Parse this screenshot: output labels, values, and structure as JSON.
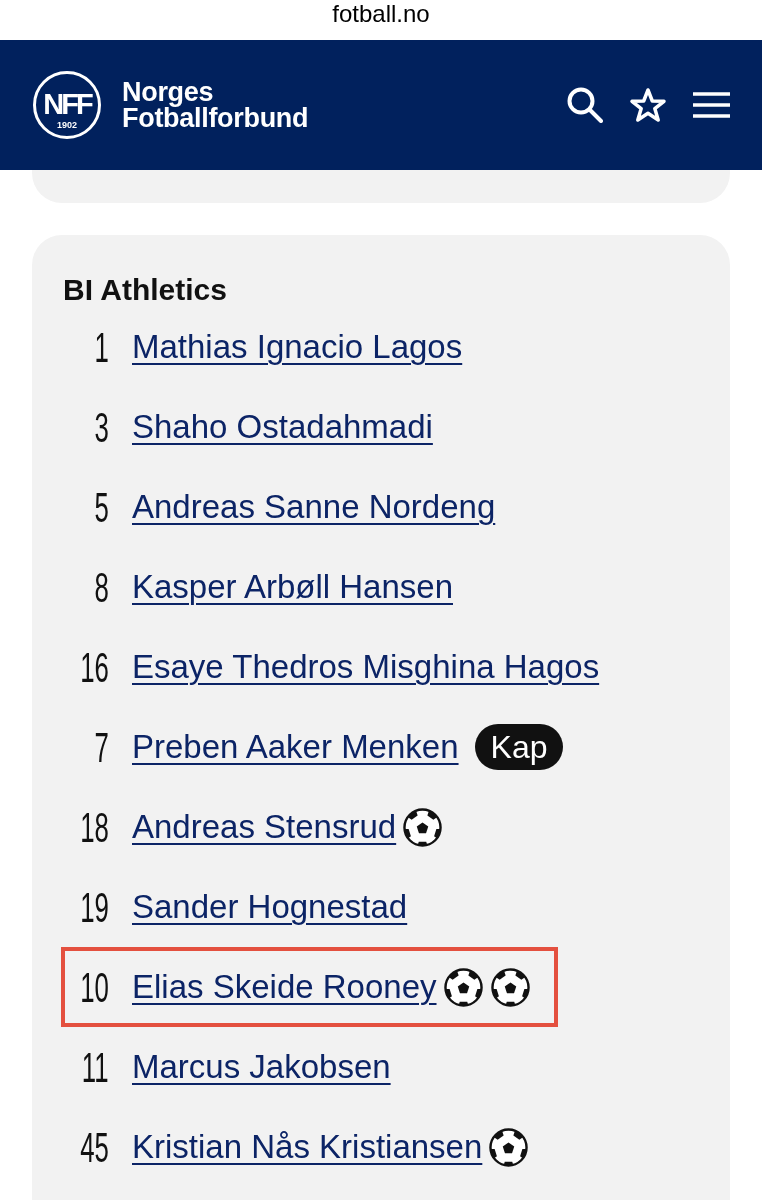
{
  "browser": {
    "address": "fotball.no"
  },
  "header": {
    "logo": {
      "monogram": "NFF",
      "year": "1902"
    },
    "title_lines": [
      "Norges",
      "Fotballforbund"
    ],
    "actions": [
      {
        "kind": "search"
      },
      {
        "kind": "favorite"
      },
      {
        "kind": "menu"
      }
    ]
  },
  "squad": {
    "team": "BI Athletics",
    "players": [
      {
        "number": "1",
        "name": "Mathias Ignacio Lagos",
        "highlighted": false
      },
      {
        "number": "3",
        "name": "Shaho Ostadahmadi",
        "highlighted": false
      },
      {
        "number": "5",
        "name": "Andreas Sanne Nordeng",
        "highlighted": false
      },
      {
        "number": "8",
        "name": "Kasper Arbøll Hansen",
        "highlighted": false
      },
      {
        "number": "16",
        "name": "Esaye Thedros Misghina Hagos",
        "highlighted": false
      },
      {
        "number": "7",
        "name": "Preben Aaker Menken",
        "tag": "Kap",
        "highlighted": false
      },
      {
        "number": "18",
        "name": "Andreas Stensrud",
        "events": [
          {
            "kind": "goal"
          }
        ],
        "highlighted": false
      },
      {
        "number": "19",
        "name": "Sander Hognestad",
        "highlighted": false
      },
      {
        "number": "10",
        "name": "Elias Skeide Rooney",
        "events": [
          {
            "kind": "goal"
          },
          {
            "kind": "goal"
          }
        ],
        "highlighted": true
      },
      {
        "number": "11",
        "name": "Marcus Jakobsen",
        "highlighted": false
      },
      {
        "number": "45",
        "name": "Kristian Nås Kristiansen",
        "events": [
          {
            "kind": "goal"
          }
        ],
        "highlighted": false
      }
    ]
  }
}
